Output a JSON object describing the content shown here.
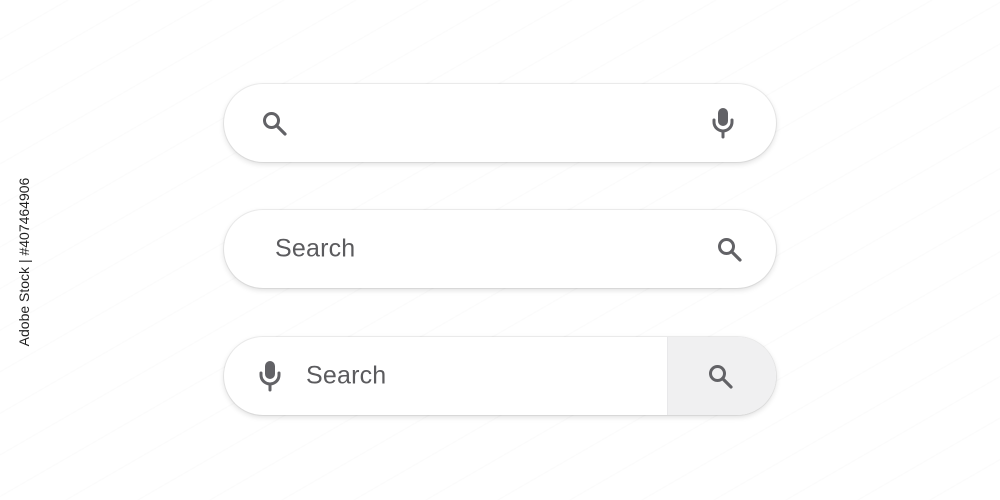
{
  "bars": [
    {
      "placeholder": "",
      "left_icon": "search-icon",
      "right_icon": "microphone-icon"
    },
    {
      "placeholder": "Search",
      "left_icon": "",
      "right_icon": "search-icon"
    },
    {
      "placeholder": "Search",
      "left_icon": "microphone-icon",
      "right_icon": "search-icon",
      "button_fill": "#f0f0f1"
    }
  ],
  "colors": {
    "icon": "#626266",
    "text": "#5b5b5e",
    "bar_bg": "#ffffff",
    "button_bg": "#f0f0f1"
  },
  "watermark": {
    "side_text": "Adobe Stock | #407464906"
  }
}
